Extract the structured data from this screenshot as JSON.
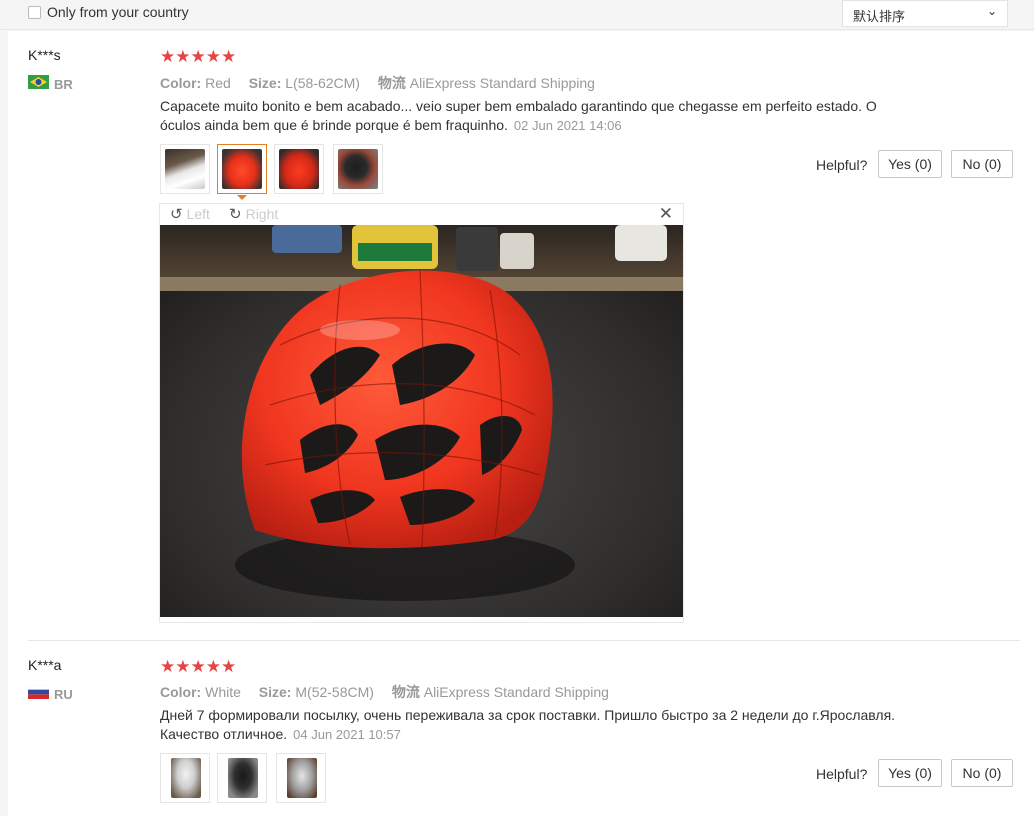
{
  "filter": {
    "country_label": "Only from your country",
    "sort_value": "默认排序",
    "sort_chevron": "⌄"
  },
  "reviews": [
    {
      "name": "K***s",
      "country": "BR",
      "stars": "★★★★★",
      "color_key": "Color:",
      "color_val": "Red",
      "size_key": "Size:",
      "size_val": "L(58-62CM)",
      "ship_key": "物流",
      "ship_val": "AliExpress Standard Shipping",
      "text": "Capacete muito bonito e bem acabado... veio super bem embalado garantindo que chegasse em perfeito estado. O óculos ainda bem que é brinde porque é bem fraquinho.",
      "date": "02 Jun 2021 14:06",
      "helpful": "Helpful?",
      "yes": "Yes (0)",
      "no": "No (0)"
    },
    {
      "name": "K***a",
      "country": "RU",
      "stars": "★★★★★",
      "color_key": "Color:",
      "color_val": "White",
      "size_key": "Size:",
      "size_val": "M(52-58CM)",
      "ship_key": "物流",
      "ship_val": "AliExpress Standard Shipping",
      "text": "Дней 7 формировали посылку, очень переживала за срок поставки. Пришло быстро за 2 недели до г.Ярославля. Качество отличное.",
      "date": "04 Jun 2021 10:57",
      "helpful": "Helpful?",
      "yes": "Yes (0)",
      "no": "No (0)"
    }
  ],
  "viewer": {
    "left_label": "Left",
    "right_label": "Right",
    "left_icon": "↺",
    "right_icon": "↻",
    "close_icon": "✕"
  }
}
